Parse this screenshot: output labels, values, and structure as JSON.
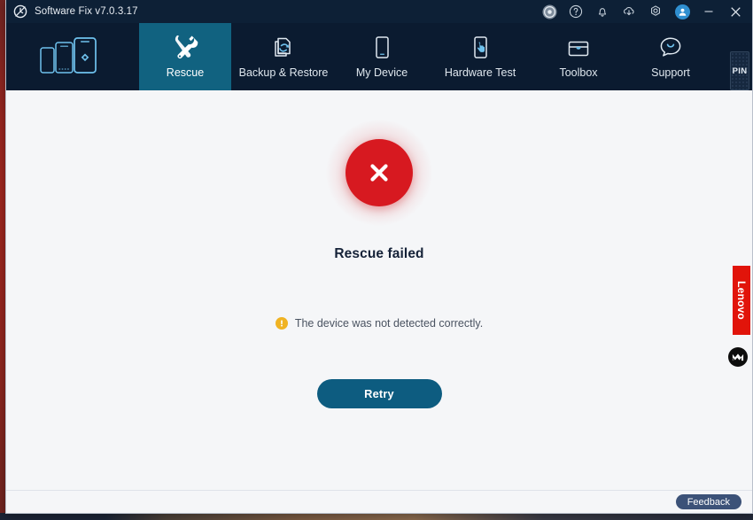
{
  "window": {
    "title": "Software Fix v7.0.3.17",
    "app_icon": "app-clock-icon"
  },
  "titlebar_icons": [
    {
      "name": "record-circle-icon",
      "label": ""
    },
    {
      "name": "help-icon",
      "label": ""
    },
    {
      "name": "notifications-bell-icon",
      "label": ""
    },
    {
      "name": "download-cloud-icon",
      "label": ""
    },
    {
      "name": "settings-gear-icon",
      "label": ""
    },
    {
      "name": "user-account-icon",
      "label": ""
    }
  ],
  "window_controls": {
    "minimize": "—",
    "close": "✕"
  },
  "nav": {
    "logo_name": "devices-logo",
    "tabs": [
      {
        "label": "Rescue",
        "icon": "wrench-screwdriver-icon",
        "active": true
      },
      {
        "label": "Backup & Restore",
        "icon": "backup-restore-icon",
        "active": false
      },
      {
        "label": "My Device",
        "icon": "phone-icon",
        "active": false
      },
      {
        "label": "Hardware Test",
        "icon": "hand-touch-icon",
        "active": false
      },
      {
        "label": "Toolbox",
        "icon": "toolbox-icon",
        "active": false
      },
      {
        "label": "Support",
        "icon": "smiley-chat-icon",
        "active": false
      }
    ],
    "pin_label": "PIN"
  },
  "main": {
    "status_icon": "error-cross-icon",
    "status_title": "Rescue failed",
    "message_icon": "warning-exclamation-icon",
    "message": "The device was not detected correctly.",
    "primary_action": "Retry"
  },
  "rail": {
    "lenovo_label": "Lenovo",
    "motorola_icon": "motorola-m-icon"
  },
  "footer": {
    "feedback_label": "Feedback"
  },
  "colors": {
    "titlebar": "#0d2036",
    "navbar": "#0b1b30",
    "active_tab": "#116280",
    "error_red": "#d71920",
    "warning_amber": "#f0b323",
    "primary_button": "#0d5c80",
    "lenovo_red": "#e1140a",
    "feedback_button": "#3c5278",
    "content_bg": "#f5f6f8"
  }
}
